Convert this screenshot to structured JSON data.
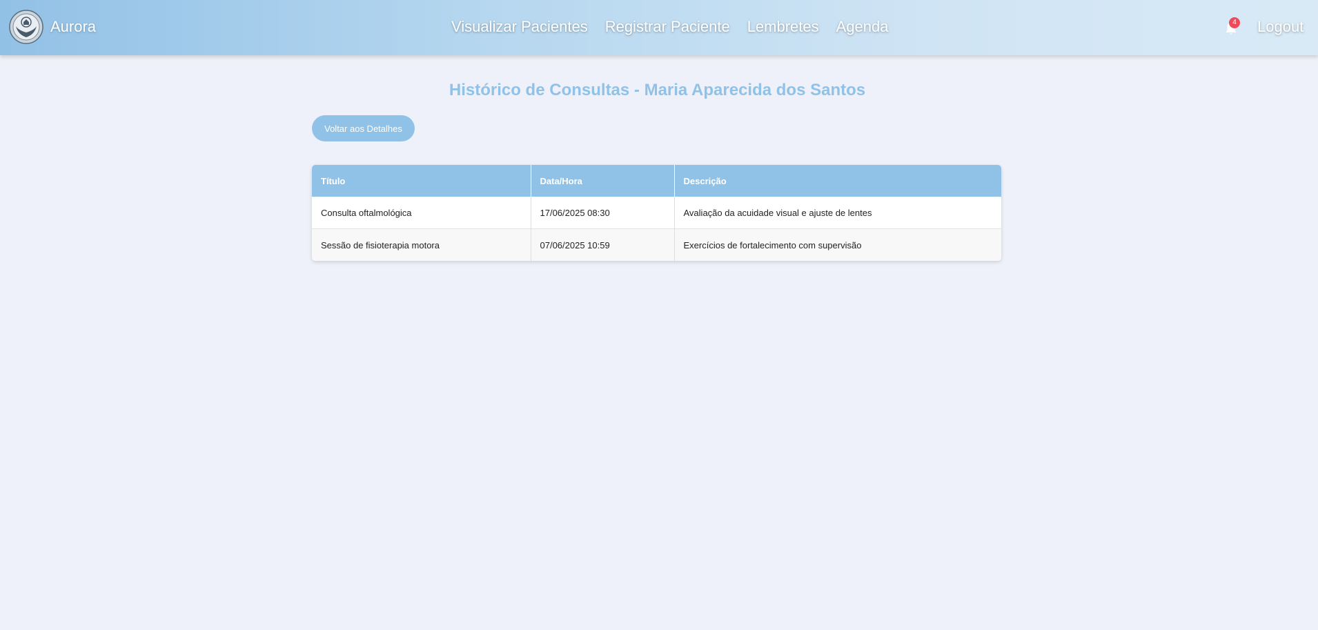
{
  "brand": {
    "name": "Aurora",
    "logo_icon": "caring-hands-icon"
  },
  "nav": {
    "items": [
      {
        "label": "Visualizar Pacientes"
      },
      {
        "label": "Registrar Paciente"
      },
      {
        "label": "Lembretes"
      },
      {
        "label": "Agenda"
      }
    ],
    "notifications": {
      "icon": "bell-icon",
      "count": "4"
    },
    "logout_label": "Logout"
  },
  "page": {
    "title": "Histórico de Consultas - Maria Aparecida dos Santos",
    "back_button_label": "Voltar aos Detalhes"
  },
  "table": {
    "headers": [
      "Título",
      "Data/Hora",
      "Descrição"
    ],
    "rows": [
      [
        "Consulta oftalmológica",
        "17/06/2025 08:30",
        "Avaliação da acuidade visual e ajuste de lentes"
      ],
      [
        "Sessão de fisioterapia motora",
        "07/06/2025 10:59",
        "Exercícios de fortalecimento com supervisão"
      ]
    ]
  },
  "colors": {
    "accent": "#90c2e7",
    "background": "#eef1f9",
    "badge": "#ef4a5a"
  }
}
